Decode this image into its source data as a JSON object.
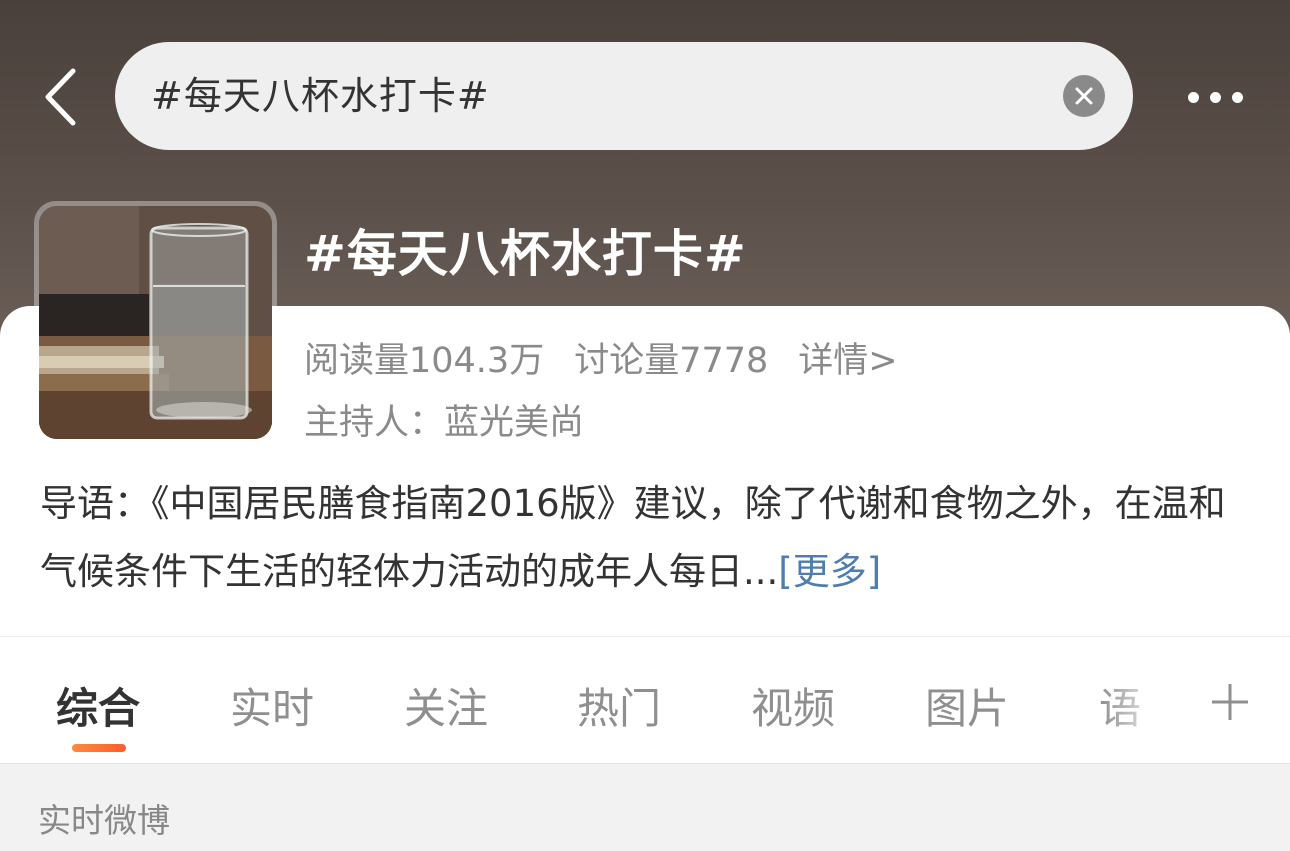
{
  "header": {
    "search_query": "#每天八杯水打卡#",
    "icons": {
      "back": "chevron-left-icon",
      "clear": "clear-circle-icon",
      "more": "more-horizontal-icon"
    }
  },
  "topic": {
    "title": "#每天八杯水打卡#",
    "thumbnail": "glass-of-water-photo",
    "reads": "阅读量104.3万",
    "discussions": "讨论量7778",
    "details": "详情>",
    "host": "主持人：蓝光美尚"
  },
  "intro": {
    "text": "导语：《中国居民膳食指南2016版》建议，除了代谢和食物之外，在温和气候条件下生活的轻体力活动的成年人每日...",
    "more": "[更多]"
  },
  "tabs": {
    "items": [
      {
        "label": "综合",
        "active": true
      },
      {
        "label": "实时"
      },
      {
        "label": "关注"
      },
      {
        "label": "热门"
      },
      {
        "label": "视频"
      },
      {
        "label": "图片"
      },
      {
        "label": "语"
      }
    ],
    "add_icon": "plus-icon"
  },
  "section": {
    "title": "实时微博"
  },
  "colors": {
    "accent": "#ff6a2f",
    "link": "#507daf",
    "header_bg": "#4f4540"
  }
}
